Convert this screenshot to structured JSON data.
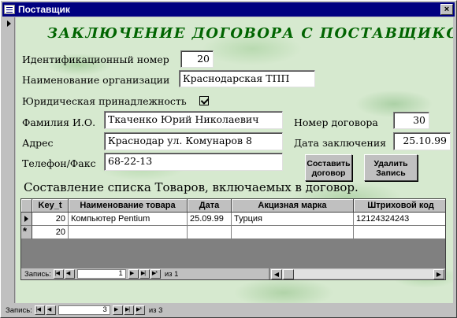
{
  "window": {
    "title": "Поставщик",
    "close_label": "×"
  },
  "form": {
    "heading": "ЗАКЛЮЧЕНИЕ ДОГОВОРА С ПОСТАВЩИКОМ",
    "fields": {
      "id_label": "Идентификационный номер",
      "id_value": "20",
      "org_label": "Наименование организации",
      "org_value": "Краснодарская ТПП",
      "legal_label": "Юридическая принадлежность",
      "legal_checked": true,
      "fio_label": "Фамилия И.О.",
      "fio_value": "Ткаченко Юрий Николаевич",
      "address_label": "Адрес",
      "address_value": "Краснодар ул. Комунаров 8",
      "phone_label": "Телефон/Факс",
      "phone_value": "68-22-13",
      "contract_no_label": "Номер договора",
      "contract_no_value": "30",
      "contract_date_label": "Дата заключения",
      "contract_date_value": "25.10.99"
    },
    "buttons": {
      "make_contract": [
        "Составить",
        "договор"
      ],
      "delete_record": [
        "Удалить",
        "Запись"
      ]
    },
    "goods_heading": "Составление списка Товаров, включаемых в договор."
  },
  "goods_table": {
    "columns": [
      "Key_t",
      "Наименование товара",
      "Дата",
      "Акцизная марка",
      "Штриховой код"
    ],
    "rows": [
      [
        "20",
        "Компьютер Pentium",
        "25.09.99",
        "Турция",
        "12124324243"
      ]
    ],
    "new_row_key": "20",
    "new_row_marker": "*"
  },
  "sub_nav": {
    "label": "Запись:",
    "current": "1",
    "of_text": "из 1"
  },
  "main_nav": {
    "label": "Запись:",
    "current": "3",
    "of_text": "из 3"
  },
  "icons": [
    "form-icon",
    "close-icon",
    "first-record-icon",
    "prev-record-icon",
    "next-record-icon",
    "last-record-icon",
    "new-record-icon",
    "current-row-icon",
    "new-row-icon"
  ]
}
